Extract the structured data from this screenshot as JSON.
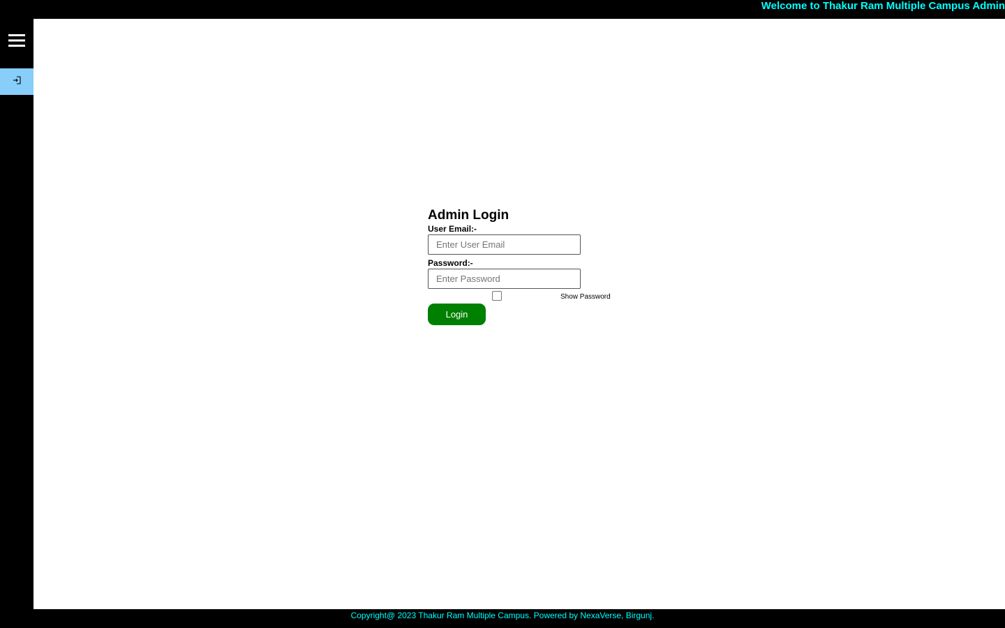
{
  "header": {
    "welcome_text": "Welcome to Thakur Ram Multiple Campus Admin"
  },
  "sidebar": {
    "menu_icon": "hamburger-menu-icon",
    "items": [
      {
        "icon": "sign-in-icon",
        "active": true
      }
    ],
    "active_color": "#87cefa"
  },
  "login_form": {
    "title": "Admin Login",
    "email_label": "User Email:-",
    "email_placeholder": "Enter User Email",
    "email_value": "",
    "password_label": "Password:-",
    "password_placeholder": "Enter Password",
    "password_value": "",
    "show_password_label": "Show Password",
    "show_password_checked": false,
    "login_button_label": "Login",
    "login_button_color": "#008000"
  },
  "footer": {
    "copyright_text": "Copyright@ 2023 Thakur Ram Multiple Campus. Powered by NexaVerse, Birgunj."
  },
  "colors": {
    "accent_text": "#00ffff",
    "chrome_background": "#000000",
    "content_background": "#ffffff"
  }
}
